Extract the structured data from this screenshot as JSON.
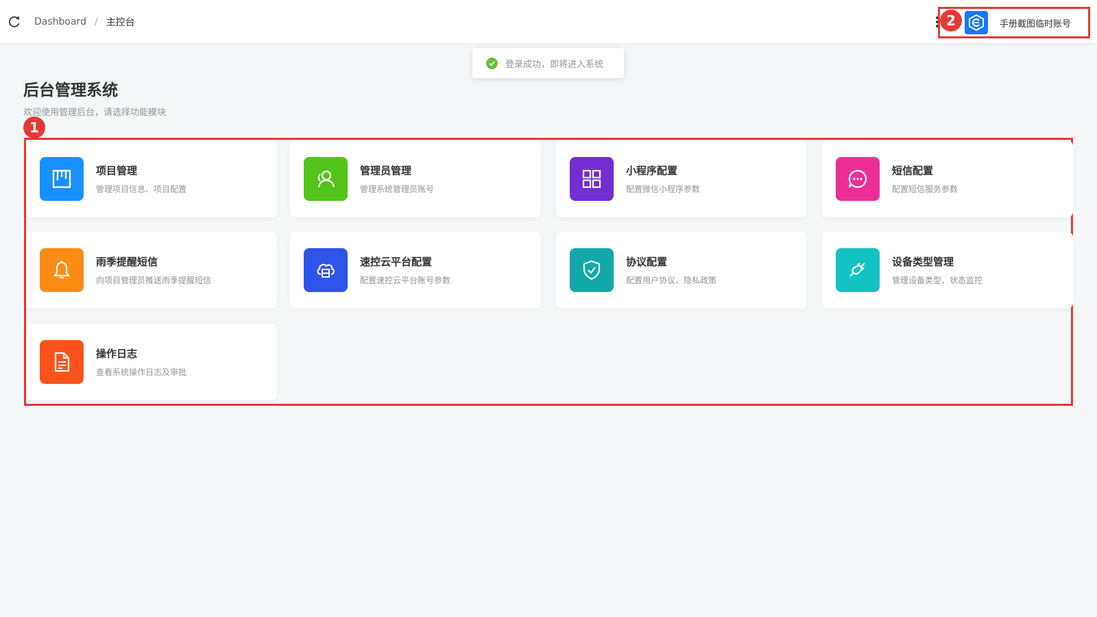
{
  "header": {
    "breadcrumb": [
      "Dashboard",
      "主控台"
    ],
    "separator": "/",
    "user_name": "手册截图临时账号"
  },
  "toast": {
    "message": "登录成功，即将进入系统",
    "status": "success"
  },
  "page": {
    "title": "后台管理系统",
    "subtitle": "欢迎使用管理后台，请选择功能模块"
  },
  "markers": [
    "1",
    "2"
  ],
  "modules": [
    {
      "title": "项目管理",
      "desc": "管理项目信息、项目配置",
      "icon": "kanban-icon",
      "color": "#1890ff"
    },
    {
      "title": "管理员管理",
      "desc": "管理系统管理员账号",
      "icon": "user-icon",
      "color": "#52c41a"
    },
    {
      "title": "小程序配置",
      "desc": "配置微信小程序参数",
      "icon": "apps-grid-icon",
      "color": "#722ed1"
    },
    {
      "title": "短信配置",
      "desc": "配置短信服务参数",
      "icon": "chat-bubble-icon",
      "color": "#eb2f96"
    },
    {
      "title": "雨季提醒短信",
      "desc": "向项目管理员推送雨季提醒短信",
      "icon": "bell-icon",
      "color": "#fa8c16"
    },
    {
      "title": "速控云平台配置",
      "desc": "配置速控云平台账号参数",
      "icon": "cloud-server-icon",
      "color": "#2f54eb"
    },
    {
      "title": "协议配置",
      "desc": "配置用户协议、隐私政策",
      "icon": "shield-check-icon",
      "color": "#13a8a8"
    },
    {
      "title": "设备类型管理",
      "desc": "管理设备类型、状态监控",
      "icon": "plug-link-icon",
      "color": "#13c2c2"
    },
    {
      "title": "操作日志",
      "desc": "查看系统操作日志及审批",
      "icon": "document-icon",
      "color": "#fa541c"
    }
  ],
  "colors": {
    "annotation": "#e53935",
    "brand": "#1677ff",
    "success": "#67c23a"
  }
}
